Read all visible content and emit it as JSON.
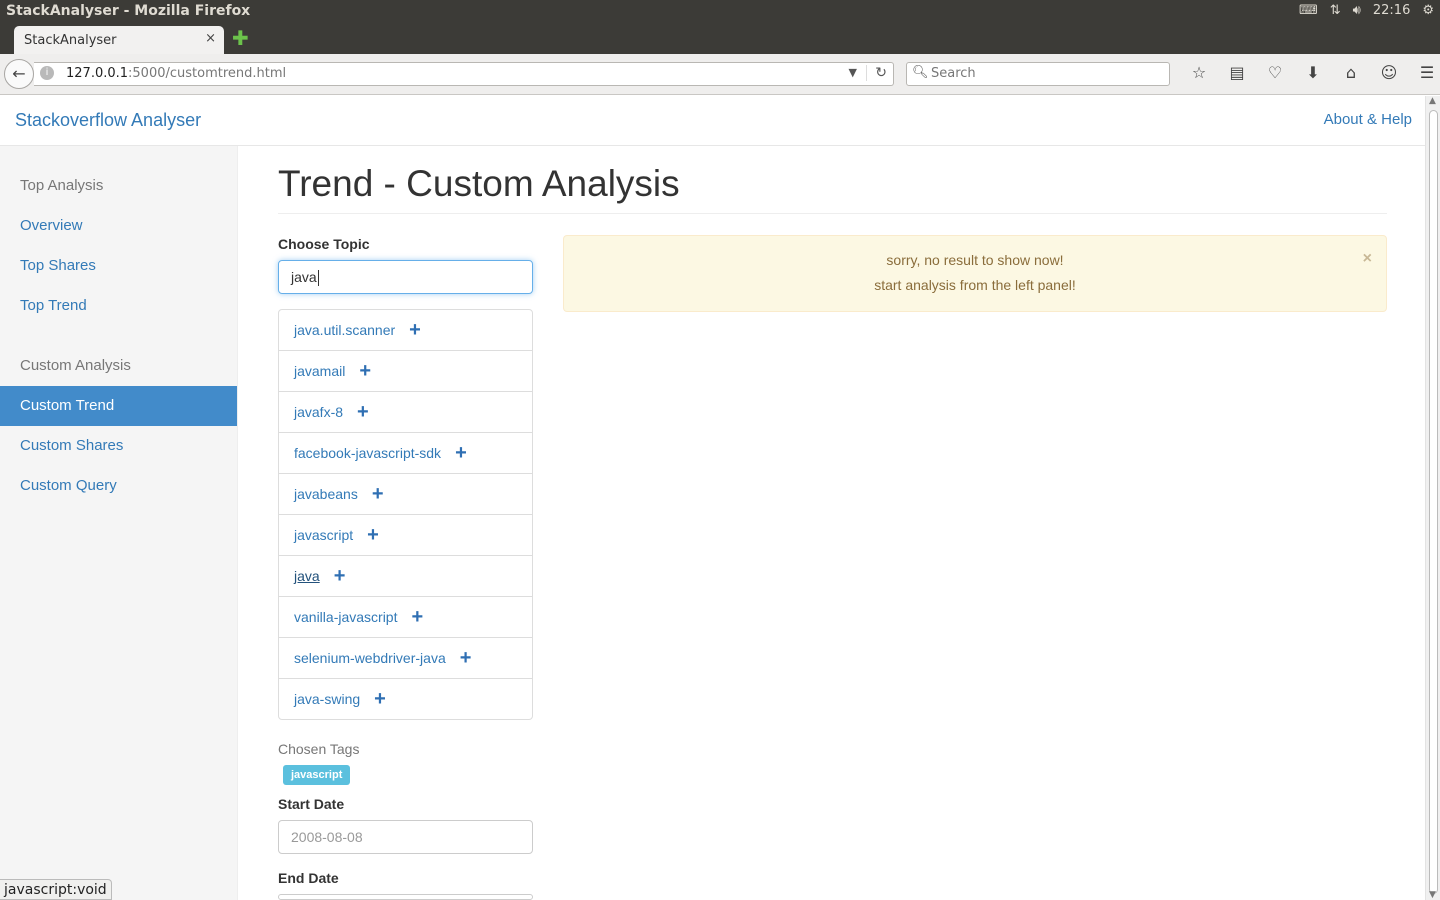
{
  "os": {
    "window_title": "StackAnalyser - Mozilla Firefox",
    "clock": "22:16"
  },
  "browser": {
    "tab_title": "StackAnalyser",
    "tab_close": "×",
    "url_host": "127.0.0.1",
    "url_path": ":5000/customtrend.html",
    "search_placeholder": "Search",
    "status_text": "javascript:void"
  },
  "header": {
    "brand": "Stackoverflow Analyser",
    "about": "About & Help"
  },
  "sidebar": {
    "items": [
      {
        "label": "Top Analysis",
        "type": "header"
      },
      {
        "label": "Overview",
        "type": "link"
      },
      {
        "label": "Top Shares",
        "type": "link"
      },
      {
        "label": "Top Trend",
        "type": "link"
      },
      {
        "label": "Custom Analysis",
        "type": "header"
      },
      {
        "label": "Custom Trend",
        "type": "active"
      },
      {
        "label": "Custom Shares",
        "type": "link"
      },
      {
        "label": "Custom Query",
        "type": "link"
      }
    ]
  },
  "main": {
    "title": "Trend - Custom Analysis",
    "choose_topic_label": "Choose Topic",
    "topic_input_value": "java",
    "suggestions": [
      "java.util.scanner",
      "javamail",
      "javafx-8",
      "facebook-javascript-sdk",
      "javabeans",
      "javascript",
      "java",
      "vanilla-javascript",
      "selenium-webdriver-java",
      "java-swing"
    ],
    "hovered_suggestion": "java",
    "chosen_tags_label": "Chosen Tags",
    "chosen_tags": [
      "javascript"
    ],
    "start_date_label": "Start Date",
    "start_date_placeholder": "2008-08-08",
    "end_date_label": "End Date"
  },
  "alert": {
    "line1": "sorry, no result to show now!",
    "line2": "start analysis from the left panel!",
    "close": "×"
  },
  "colors": {
    "link": "#337ab7",
    "active_bg": "#428bca",
    "alert_bg": "#fcf8e3",
    "alert_text": "#8a6d3b",
    "badge_bg": "#5bc0de"
  }
}
